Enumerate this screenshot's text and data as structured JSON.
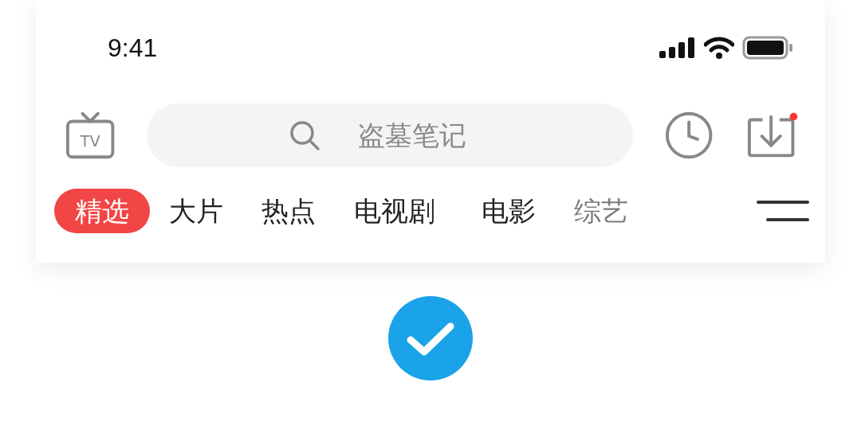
{
  "status_bar": {
    "time": "9:41"
  },
  "tv_button": {
    "label": "TV"
  },
  "search": {
    "placeholder": "盗墓笔记"
  },
  "download": {
    "badge": true
  },
  "tabs": [
    {
      "label": "精选",
      "selected": true
    },
    {
      "label": "大片",
      "selected": false
    },
    {
      "label": "热点",
      "selected": false
    },
    {
      "label": "电视剧",
      "selected": false
    },
    {
      "label": "电影",
      "selected": false
    },
    {
      "label": "综艺",
      "selected": false
    }
  ],
  "confirmation": {
    "checked": true
  }
}
